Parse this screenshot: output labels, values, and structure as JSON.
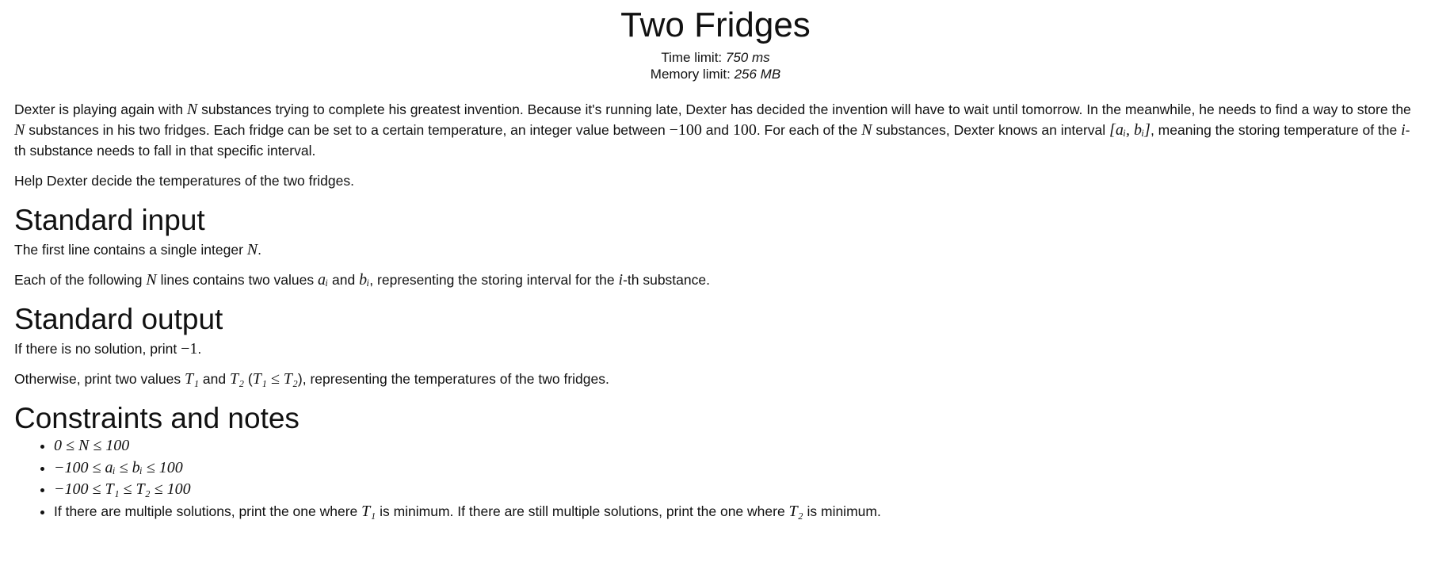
{
  "problem": {
    "title": "Two Fridges",
    "time_limit_label": "Time limit:",
    "time_limit_value": "750 ms",
    "memory_limit_label": "Memory limit:",
    "memory_limit_value": "256 MB"
  },
  "statement": {
    "p1": {
      "t1": "Dexter is playing again with ",
      "v1": "N",
      "t2": " substances trying to complete his greatest invention. Because it's running late, Dexter has decided the invention will have to wait until tomorrow. In the meanwhile, he needs to find a way to store the ",
      "v2": "N",
      "t3": " substances in his two fridges. Each fridge can be set to a certain temperature, an integer value between ",
      "n1": "−100",
      "t4": " and ",
      "n2": "100",
      "t5": ". For each of the ",
      "v3": "N",
      "t6": " substances, Dexter knows an interval ",
      "interval": "[aᵢ, bᵢ]",
      "t7": ", meaning the storing temperature of the ",
      "v4": "i",
      "t8": "-th substance needs to fall in that specific interval."
    },
    "p2": "Help Dexter decide the temperatures of the two fridges."
  },
  "input_section": {
    "heading": "Standard input",
    "l1_t1": "The first line contains a single integer ",
    "l1_v1": "N",
    "l1_t2": ".",
    "l2_t1": "Each of the following ",
    "l2_v1": "N",
    "l2_t2": " lines contains two values ",
    "l2_v2": "aᵢ",
    "l2_t3": " and ",
    "l2_v3": "bᵢ",
    "l2_t4": ", representing the storing interval for the ",
    "l2_v4": "i",
    "l2_t5": "-th substance."
  },
  "output_section": {
    "heading": "Standard output",
    "l1_t1": "If there is no solution, print ",
    "l1_n1": "−1",
    "l1_t2": ".",
    "l2_t1": "Otherwise, print two values ",
    "l2_v1": "T₁",
    "l2_t2": " and ",
    "l2_v2": "T₂",
    "l2_t3": " (",
    "l2_v3": "T₁ ≤ T₂",
    "l2_t4": "), representing the temperatures of the two fridges."
  },
  "constraints_section": {
    "heading": "Constraints and notes",
    "c1": "0 ≤ N ≤ 100",
    "c2": "−100 ≤ aᵢ ≤ bᵢ ≤ 100",
    "c3": "−100 ≤ T₁ ≤ T₂ ≤ 100",
    "c4_t1": "If there are multiple solutions, print the one where ",
    "c4_v1": "T₁",
    "c4_t2": " is minimum. If there are still multiple solutions, print the one where ",
    "c4_v2": "T₂",
    "c4_t3": " is minimum."
  }
}
